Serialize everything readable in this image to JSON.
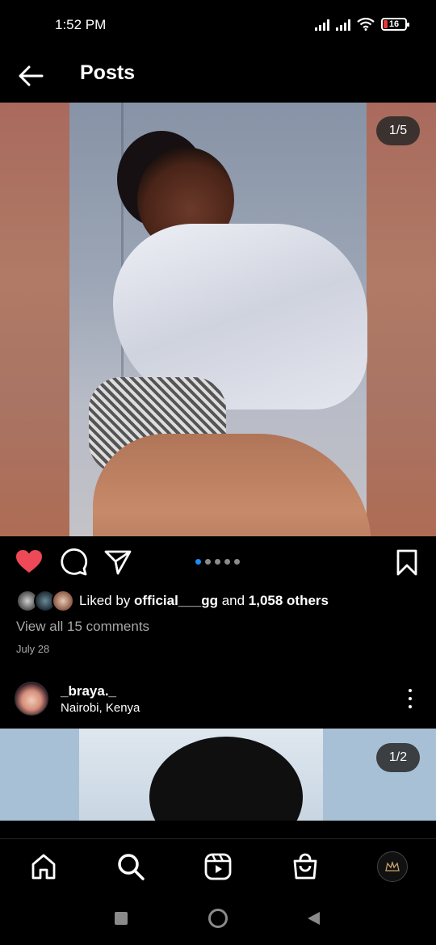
{
  "status_bar": {
    "time": "1:52 PM",
    "battery": "16"
  },
  "header": {
    "title": "Posts"
  },
  "post": {
    "image_counter": "1/5",
    "carousel_dots": 5,
    "active_dot": 0,
    "likes": {
      "prefix": "Liked by ",
      "user": "official___gg",
      "middle": " and ",
      "others": "1,058 others"
    },
    "comments_link": "View all 15 comments",
    "date": "July 28",
    "like_color": "#ed4956"
  },
  "next_post": {
    "username": "_braya._",
    "location": "Nairobi, Kenya",
    "image_counter": "1/2"
  },
  "tabs": [
    "home-tab",
    "search-tab",
    "reels-tab",
    "shop-tab",
    "profile-tab"
  ],
  "colors": {
    "accent": "#1d8cf8",
    "muted": "#a8a8a8",
    "background": "#000000"
  }
}
